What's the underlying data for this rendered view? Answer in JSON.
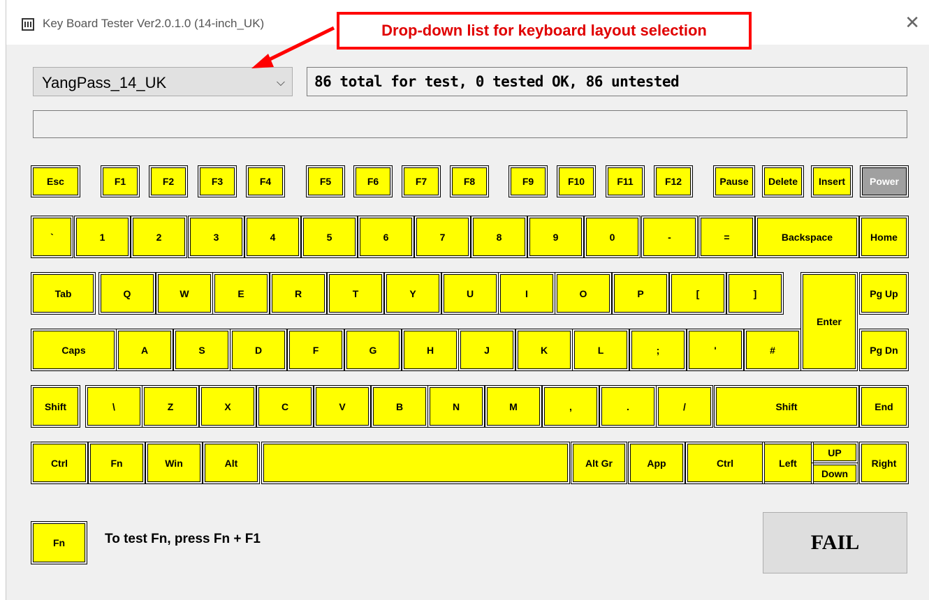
{
  "window": {
    "title": "Key Board Tester Ver2.0.1.0 (14-inch_UK)",
    "app_icon": "keyboard-grid-icon",
    "close_icon": "close-icon"
  },
  "annotation": {
    "text": "Drop-down list for keyboard layout selection",
    "color": "#ff0000"
  },
  "layout_select": {
    "value": "YangPass_14_UK",
    "icon": "chevron-down-icon"
  },
  "status": {
    "summary": "86 total for test, 0 tested OK, 86 untested",
    "secondary": ""
  },
  "colors": {
    "untested": "#ffff00",
    "unavailable": "#a0a0a0"
  },
  "keys": {
    "esc": "Esc",
    "f1": "F1",
    "f2": "F2",
    "f3": "F3",
    "f4": "F4",
    "f5": "F5",
    "f6": "F6",
    "f7": "F7",
    "f8": "F8",
    "f9": "F9",
    "f10": "F10",
    "f11": "F11",
    "f12": "F12",
    "pause": "Pause",
    "delete": "Delete",
    "insert": "Insert",
    "power": "Power",
    "backtick": "`",
    "n1": "1",
    "n2": "2",
    "n3": "3",
    "n4": "4",
    "n5": "5",
    "n6": "6",
    "n7": "7",
    "n8": "8",
    "n9": "9",
    "n0": "0",
    "minus": "-",
    "equals": "=",
    "backspace": "Backspace",
    "home": "Home",
    "tab": "Tab",
    "q": "Q",
    "w": "W",
    "e": "E",
    "r": "R",
    "t": "T",
    "y": "Y",
    "u": "U",
    "i": "I",
    "o": "O",
    "p": "P",
    "lbracket": "[",
    "rbracket": "]",
    "enter": "Enter",
    "pgup": "Pg Up",
    "caps": "Caps",
    "a": "A",
    "s": "S",
    "d": "D",
    "f": "F",
    "g": "G",
    "h": "H",
    "j": "J",
    "k": "K",
    "l": "L",
    "semicolon": ";",
    "quote": "'",
    "hash": "#",
    "pgdn": "Pg Dn",
    "lshift": "Shift",
    "backslash": "\\",
    "z": "Z",
    "x": "X",
    "c": "C",
    "v": "V",
    "b": "B",
    "n": "N",
    "m": "M",
    "comma": ",",
    "period": ".",
    "slash": "/",
    "rshift": "Shift",
    "end": "End",
    "lctrl": "Ctrl",
    "fn": "Fn",
    "win": "Win",
    "alt": "Alt",
    "space": "",
    "altgr": "Alt Gr",
    "app": "App",
    "rctrl": "Ctrl",
    "left": "Left",
    "up": "UP",
    "down": "Down",
    "right": "Right"
  },
  "fn_hint": {
    "key": "Fn",
    "text": "To test Fn, press Fn + F1"
  },
  "result": {
    "label": "FAIL"
  }
}
